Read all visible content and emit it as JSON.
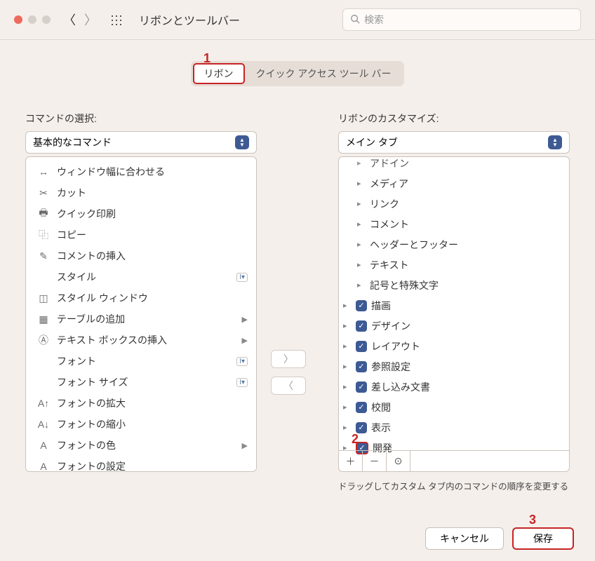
{
  "window": {
    "title": "リボンとツールバー",
    "search_placeholder": "検索"
  },
  "tabs": {
    "ribbon": "リボン",
    "qat": "クイック アクセス ツール バー"
  },
  "left": {
    "label": "コマンドの選択:",
    "select_value": "基本的なコマンド",
    "commands": [
      {
        "icon": "fit-width-icon",
        "label": "ウィンドウ幅に合わせる"
      },
      {
        "icon": "cut-icon",
        "label": "カット"
      },
      {
        "icon": "print-icon",
        "label": "クイック印刷"
      },
      {
        "icon": "copy-icon",
        "label": "コピー"
      },
      {
        "icon": "comment-icon",
        "label": "コメントの挿入"
      },
      {
        "icon": "",
        "label": "スタイル",
        "badge": "I▾"
      },
      {
        "icon": "style-window-icon",
        "label": "スタイル ウィンドウ"
      },
      {
        "icon": "table-icon",
        "label": "テーブルの追加",
        "sub": true
      },
      {
        "icon": "textbox-icon",
        "label": "テキスト ボックスの挿入",
        "sub": true
      },
      {
        "icon": "",
        "label": "フォント",
        "badge": "I▾"
      },
      {
        "icon": "",
        "label": "フォント サイズ",
        "badge": "I▾"
      },
      {
        "icon": "font-grow-icon",
        "label": "フォントの拡大"
      },
      {
        "icon": "font-shrink-icon",
        "label": "フォントの縮小"
      },
      {
        "icon": "font-color-icon",
        "label": "フォントの色",
        "sub": true
      },
      {
        "icon": "font-settings-icon",
        "label": "フォントの設定"
      }
    ]
  },
  "right": {
    "label": "リボンのカスタマイズ:",
    "select_value": "メイン タブ",
    "tree_top": [
      {
        "label": "アドイン",
        "truncated": true
      },
      {
        "label": "メディア"
      },
      {
        "label": "リンク"
      },
      {
        "label": "コメント"
      },
      {
        "label": "ヘッダーとフッター"
      },
      {
        "label": "テキスト"
      },
      {
        "label": "記号と特殊文字"
      }
    ],
    "tree_checked": [
      {
        "label": "描画"
      },
      {
        "label": "デザイン"
      },
      {
        "label": "レイアウト"
      },
      {
        "label": "参照設定"
      },
      {
        "label": "差し込み文書"
      },
      {
        "label": "校閲"
      },
      {
        "label": "表示"
      },
      {
        "label": "開発",
        "highlight": true
      }
    ],
    "hint": "ドラッグしてカスタム タブ内のコマンドの順序を変更する"
  },
  "footer": {
    "cancel": "キャンセル",
    "save": "保存"
  },
  "annotations": {
    "one": "1",
    "two": "2",
    "three": "3"
  }
}
